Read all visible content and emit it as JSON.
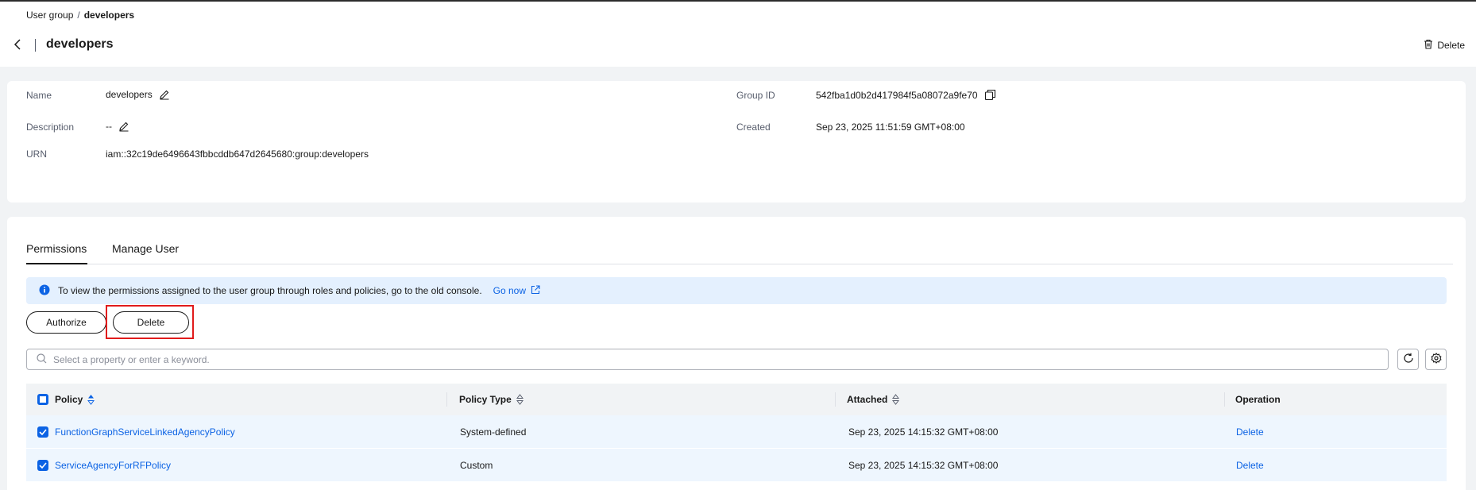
{
  "breadcrumb": {
    "parent": "User group",
    "separator": "/",
    "current": "developers"
  },
  "header": {
    "title": "developers",
    "delete_label": "Delete"
  },
  "info": {
    "name_label": "Name",
    "name_value": "developers",
    "description_label": "Description",
    "description_value": "--",
    "urn_label": "URN",
    "urn_value": "iam::32c19de6496643fbbcddb647d2645680:group:developers",
    "group_id_label": "Group ID",
    "group_id_value": "542fba1d0b2d417984f5a08072a9fe70",
    "created_label": "Created",
    "created_value": "Sep 23, 2025 11:51:59 GMT+08:00"
  },
  "tabs": [
    {
      "label": "Permissions",
      "active": true
    },
    {
      "label": "Manage User",
      "active": false
    }
  ],
  "notice": {
    "text": "To view the permissions assigned to the user group through roles and policies, go to the old console.",
    "link": "Go now"
  },
  "actions": {
    "authorize_label": "Authorize",
    "delete_label": "Delete"
  },
  "search": {
    "placeholder": "Select a property or enter a keyword."
  },
  "table": {
    "columns": [
      "Policy",
      "Policy Type",
      "Attached",
      "Operation"
    ],
    "rows": [
      {
        "policy": "FunctionGraphServiceLinkedAgencyPolicy",
        "type": "System-defined",
        "attached": "Sep 23, 2025 14:15:32 GMT+08:00",
        "operation": "Delete",
        "checked": true
      },
      {
        "policy": "ServiceAgencyForRFPolicy",
        "type": "Custom",
        "attached": "Sep 23, 2025 14:15:32 GMT+08:00",
        "operation": "Delete",
        "checked": true
      }
    ]
  },
  "colors": {
    "accent": "#0c63e4",
    "highlight": "#e11b1b",
    "notice_bg": "#e4f0fe",
    "row_selected": "#eef6fe"
  },
  "icons": [
    "back-arrow-icon",
    "trash-icon",
    "edit-icon",
    "copy-icon",
    "info-icon",
    "external-link-icon",
    "search-icon",
    "refresh-icon",
    "settings-icon",
    "sort-icon",
    "checkbox-partial-icon",
    "checkbox-checked-icon"
  ]
}
